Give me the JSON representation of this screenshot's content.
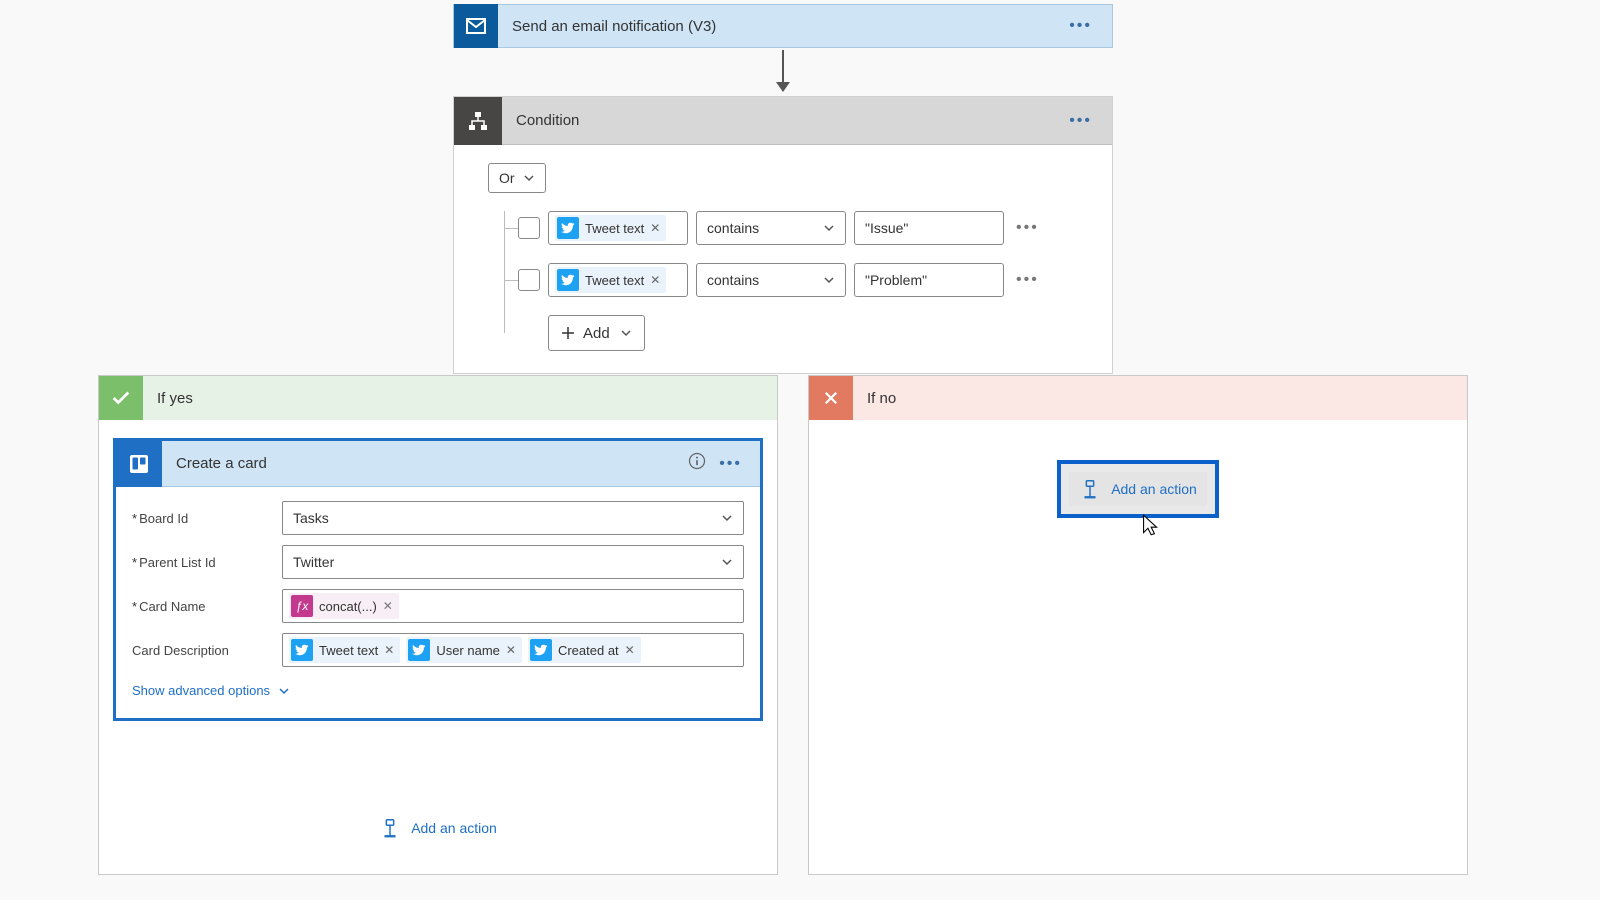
{
  "email_step": {
    "title": "Send an email notification (V3)"
  },
  "condition": {
    "title": "Condition",
    "logic": "Or",
    "rows": [
      {
        "field_token": "Tweet text",
        "operator": "contains",
        "value": "\"Issue\""
      },
      {
        "field_token": "Tweet text",
        "operator": "contains",
        "value": "\"Problem\""
      }
    ],
    "add_label": "Add"
  },
  "branches": {
    "yes": {
      "title": "If yes",
      "action": {
        "title": "Create a card",
        "fields": {
          "board_id": {
            "label": "Board Id",
            "required": true,
            "value": "Tasks"
          },
          "parent_list": {
            "label": "Parent List Id",
            "required": true,
            "value": "Twitter"
          },
          "card_name": {
            "label": "Card Name",
            "required": true,
            "tokens": [
              {
                "type": "fx",
                "text": "concat(...)"
              }
            ]
          },
          "card_desc": {
            "label": "Card Description",
            "required": false,
            "tokens": [
              {
                "type": "twitter",
                "text": "Tweet text"
              },
              {
                "type": "twitter",
                "text": "User name"
              },
              {
                "type": "twitter",
                "text": "Created at"
              }
            ]
          }
        },
        "advanced_label": "Show advanced options"
      },
      "add_action_label": "Add an action"
    },
    "no": {
      "title": "If no",
      "add_action_label": "Add an action"
    }
  }
}
